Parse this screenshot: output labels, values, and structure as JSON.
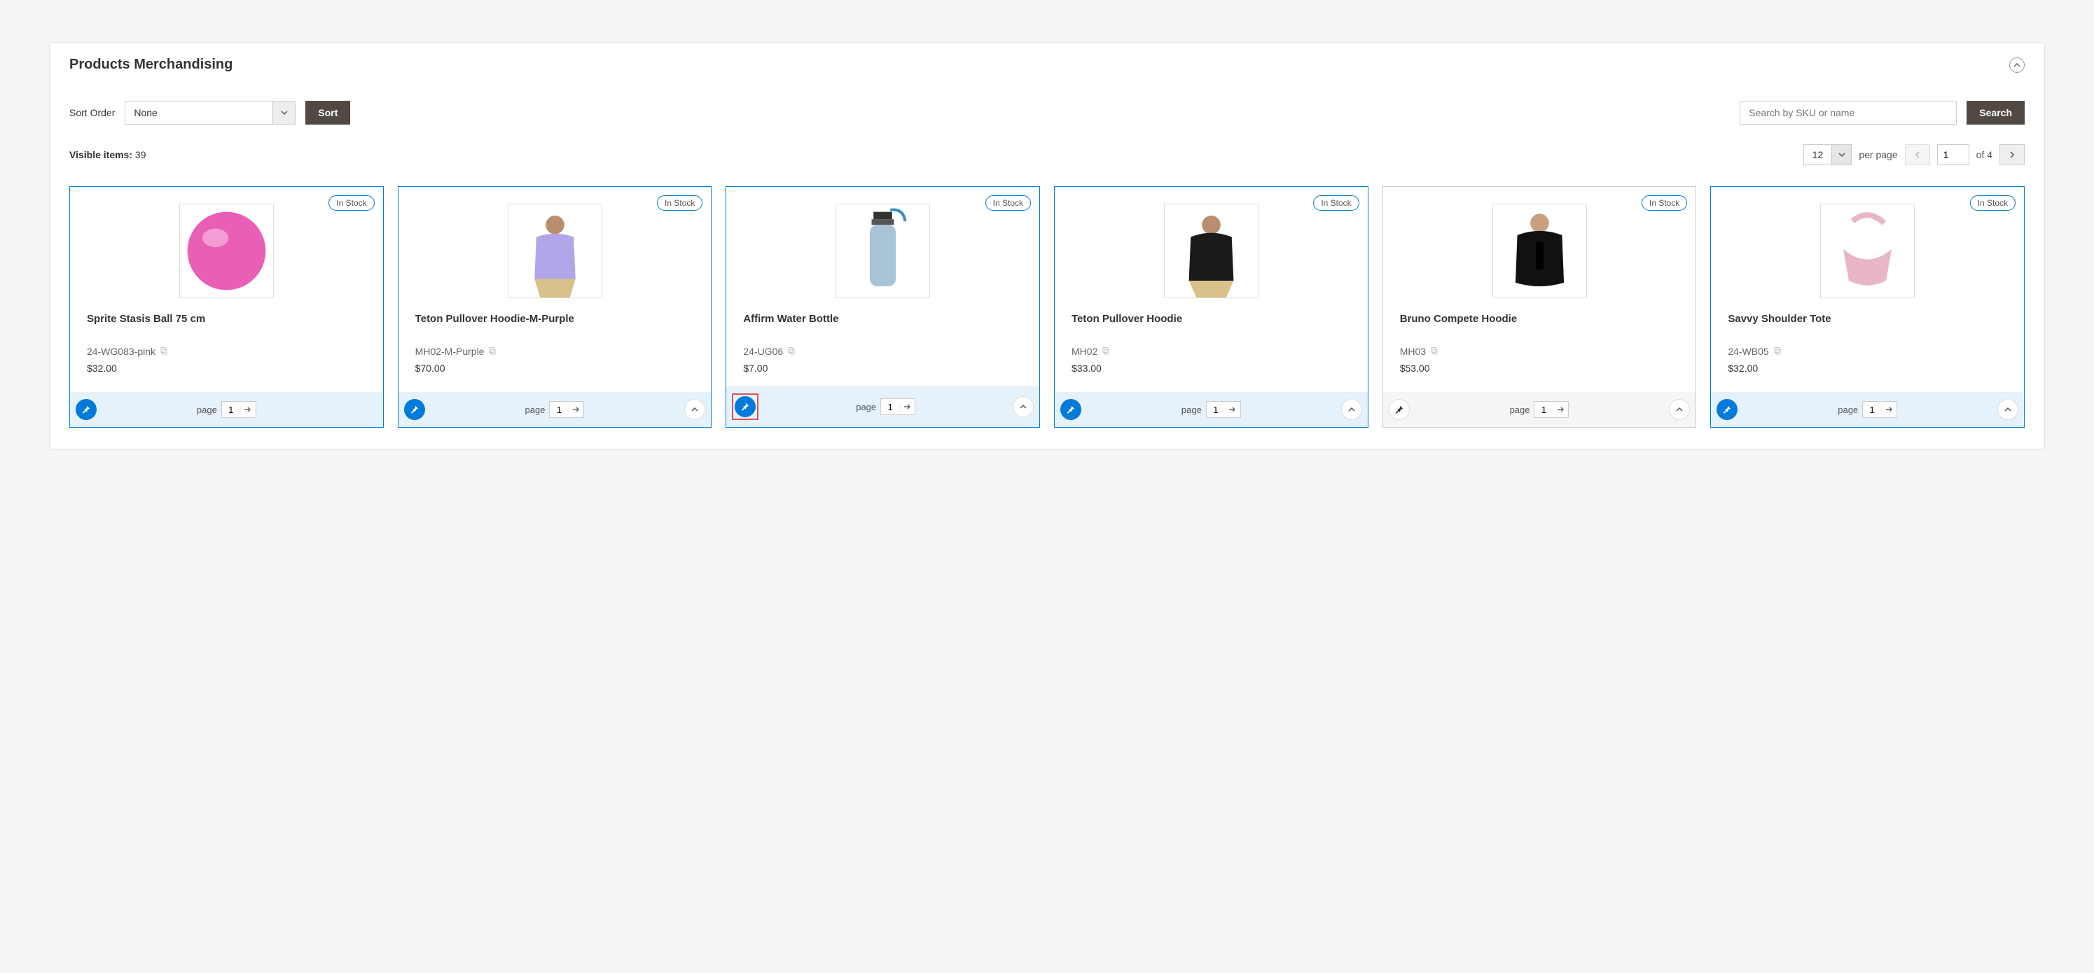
{
  "panel": {
    "title": "Products Merchandising"
  },
  "sort": {
    "label": "Sort Order",
    "value": "None",
    "button": "Sort"
  },
  "search": {
    "placeholder": "Search by SKU or name",
    "button": "Search"
  },
  "visible": {
    "label": "Visible items:",
    "count": "39"
  },
  "pager": {
    "per_page_value": "12",
    "per_page_label": "per page",
    "current_page": "1",
    "of_label": "of",
    "total_pages": "4"
  },
  "card_common": {
    "page_label": "page",
    "page_value": "1"
  },
  "products": [
    {
      "name": "Sprite Stasis Ball 75 cm",
      "sku": "24-WG083-pink",
      "price": "$32.00",
      "stock": "In Stock",
      "pinned": true,
      "show_move_to_top": false,
      "highlight_pin": false
    },
    {
      "name": "Teton Pullover Hoodie-M-Purple",
      "sku": "MH02-M-Purple",
      "price": "$70.00",
      "stock": "In Stock",
      "pinned": true,
      "show_move_to_top": true,
      "highlight_pin": false
    },
    {
      "name": "Affirm Water Bottle",
      "sku": "24-UG06",
      "price": "$7.00",
      "stock": "In Stock",
      "pinned": true,
      "show_move_to_top": true,
      "highlight_pin": true
    },
    {
      "name": "Teton Pullover Hoodie",
      "sku": "MH02",
      "price": "$33.00",
      "stock": "In Stock",
      "pinned": true,
      "show_move_to_top": true,
      "highlight_pin": false
    },
    {
      "name": "Bruno Compete Hoodie",
      "sku": "MH03",
      "price": "$53.00",
      "stock": "In Stock",
      "pinned": false,
      "show_move_to_top": true,
      "highlight_pin": false
    },
    {
      "name": "Savvy Shoulder Tote",
      "sku": "24-WB05",
      "price": "$32.00",
      "stock": "In Stock",
      "pinned": true,
      "show_move_to_top": true,
      "highlight_pin": false
    }
  ]
}
